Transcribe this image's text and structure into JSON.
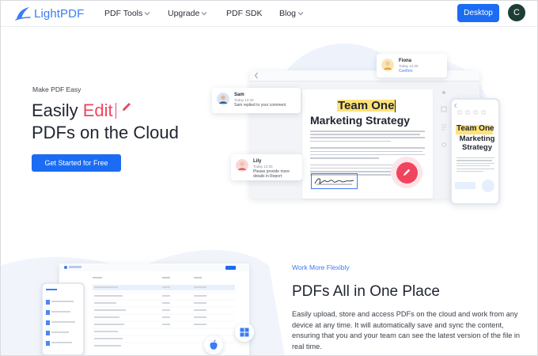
{
  "header": {
    "logo": "LightPDF",
    "nav": [
      {
        "label": "PDF Tools",
        "has_dropdown": true
      },
      {
        "label": "Upgrade",
        "has_dropdown": true
      },
      {
        "label": "PDF SDK",
        "has_dropdown": false
      },
      {
        "label": "Blog",
        "has_dropdown": true
      }
    ],
    "desktop_button": "Desktop",
    "avatar_letter": "C"
  },
  "hero": {
    "eyebrow": "Make PDF Easy",
    "title_prefix": "Easily",
    "title_accent": "Edit",
    "title_line2": "PDFs on the Cloud",
    "cta": "Get Started for Free",
    "accent_color": "#f0445e",
    "primary_color": "#1b6cf2"
  },
  "mockup": {
    "doc_title_1": "Team One",
    "doc_title_2": "Marketing Strategy",
    "comments": [
      {
        "name": "Sam",
        "time": "Today 12:20",
        "message": "Sam replied to your comment"
      },
      {
        "name": "Lily",
        "time": "Today 12:20",
        "message": "Please provide more details in Report"
      },
      {
        "name": "Fiona",
        "time": "Today 12:30",
        "message": "Confirm"
      }
    ],
    "phone_title_1": "Team One",
    "phone_title_2": "Marketing Strategy"
  },
  "section2": {
    "eyebrow": "Work More Flexibly",
    "title": "PDFs All in One Place",
    "body": "Easily upload, store and access PDFs on the cloud and work from any device at any time. It will automatically save and sync the content, ensuring that you and your team can see the latest version of the file in real time.",
    "app_logo": "LightPDF",
    "os_icons": [
      "apple-icon",
      "windows-icon"
    ]
  }
}
